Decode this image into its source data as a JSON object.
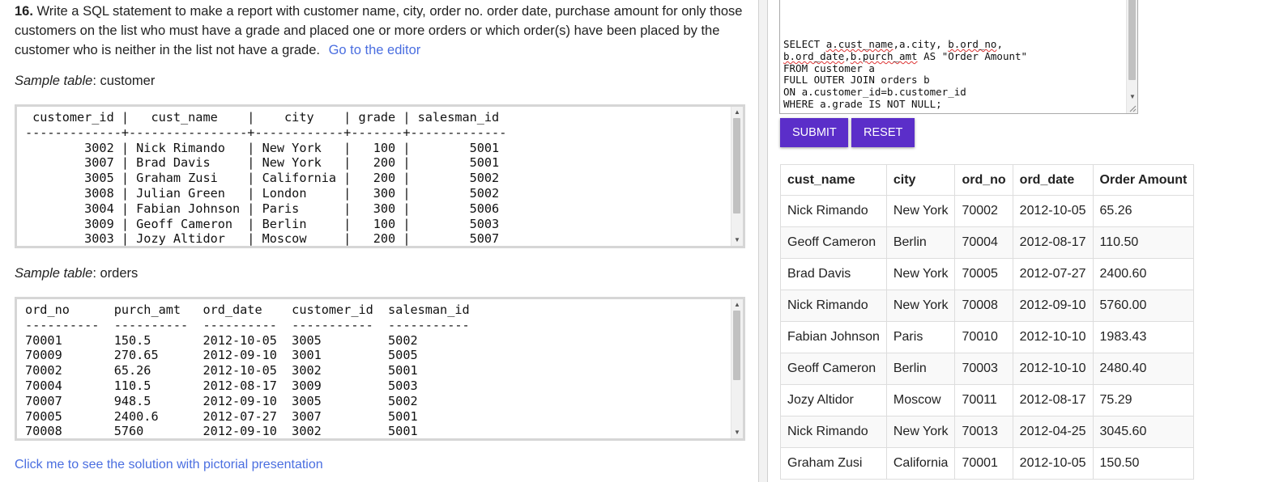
{
  "question": {
    "number": "16.",
    "text": "Write a SQL statement to make a report with customer name, city, order no. order date, purchase amount for only those customers on the list who must have a grade and placed one or more orders or which order(s) have been placed by the customer who is neither in the list not have a grade.",
    "editor_link": "Go to the editor"
  },
  "customer_sample": {
    "label_italic": "Sample table",
    "label_rest": ": customer",
    "text": " customer_id |   cust_name    |    city    | grade | salesman_id \n-------------+----------------+------------+-------+-------------\n        3002 | Nick Rimando   | New York   |   100 |        5001\n        3007 | Brad Davis     | New York   |   200 |        5001\n        3005 | Graham Zusi    | California |   200 |        5002\n        3008 | Julian Green   | London     |   300 |        5002\n        3004 | Fabian Johnson | Paris      |   300 |        5006\n        3009 | Geoff Cameron  | Berlin     |   100 |        5003\n        3003 | Jozy Altidor   | Moscow     |   200 |        5007"
  },
  "orders_sample": {
    "label_italic": "Sample table",
    "label_rest": ": orders",
    "text": "ord_no      purch_amt   ord_date    customer_id  salesman_id\n----------  ----------  ----------  -----------  -----------\n70001       150.5       2012-10-05  3005         5002\n70009       270.65      2012-09-10  3001         5005\n70002       65.26       2012-10-05  3002         5001\n70004       110.5       2012-08-17  3009         5003\n70007       948.5       2012-09-10  3005         5002\n70005       2400.6      2012-07-27  3007         5001\n70008       5760        2012-09-10  3002         5001"
  },
  "pictorial_link": "Click me to see the solution with pictorial presentation",
  "sql_editor": {
    "l1a": "SELECT ",
    "l1b": "a.cust_name",
    "l1c": ",a.city, ",
    "l1d": "b.ord_no",
    "l1e": ",",
    "l2a": "b.ord_date",
    "l2b": ",",
    "l2c": "b.purch_amt",
    "l2d": " AS \"Order Amount\"",
    "l3": "FROM customer a",
    "l4": "FULL OUTER JOIN orders b",
    "l5": "ON a.customer_id=b.customer_id",
    "l6": "WHERE a.grade IS NOT NULL;"
  },
  "buttons": {
    "submit": "SUBMIT",
    "reset": "RESET"
  },
  "result_table": {
    "headers": [
      "cust_name",
      "city",
      "ord_no",
      "ord_date",
      "Order Amount"
    ],
    "rows": [
      [
        "Nick Rimando",
        "New York",
        "70002",
        "2012-10-05",
        "65.26"
      ],
      [
        "Geoff Cameron",
        "Berlin",
        "70004",
        "2012-08-17",
        "110.50"
      ],
      [
        "Brad Davis",
        "New York",
        "70005",
        "2012-07-27",
        "2400.60"
      ],
      [
        "Nick Rimando",
        "New York",
        "70008",
        "2012-09-10",
        "5760.00"
      ],
      [
        "Fabian Johnson",
        "Paris",
        "70010",
        "2012-10-10",
        "1983.43"
      ],
      [
        "Geoff Cameron",
        "Berlin",
        "70003",
        "2012-10-10",
        "2480.40"
      ],
      [
        "Jozy Altidor",
        "Moscow",
        "70011",
        "2012-08-17",
        "75.29"
      ],
      [
        "Nick Rimando",
        "New York",
        "70013",
        "2012-04-25",
        "3045.60"
      ],
      [
        "Graham Zusi",
        "California",
        "70001",
        "2012-10-05",
        "150.50"
      ]
    ]
  },
  "colors": {
    "link": "#4a6ee0",
    "button": "#5b2ec9",
    "spellcheck": "#d33"
  }
}
